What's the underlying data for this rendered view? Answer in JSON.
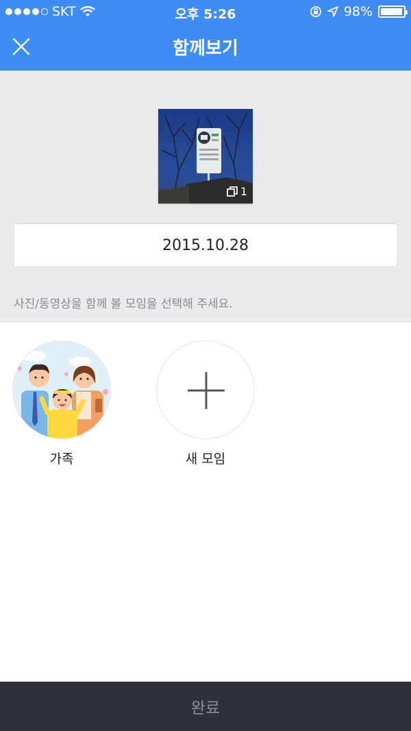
{
  "status_bar": {
    "carrier": "SKT",
    "time": "오후 5:26",
    "battery": "98%",
    "battery_level": 0.98
  },
  "header": {
    "title": "함께보기",
    "close_icon": "close-icon"
  },
  "photo": {
    "count": "1",
    "count_icon": "multi-photo-icon"
  },
  "date_field": {
    "value": "2015.10.28"
  },
  "hint": "사진/동영상을 함께 볼 모임을 선택해 주세요.",
  "groups": [
    {
      "label": "가족",
      "icon": "family-illustration"
    },
    {
      "label": "새 모임",
      "icon": "plus-icon"
    }
  ],
  "footer": {
    "done_label": "완료"
  },
  "colors": {
    "accent": "#3f8cf5",
    "background_grey": "#ebebee",
    "footer_bg": "#2f323a",
    "footer_text": "#8b8e96"
  }
}
